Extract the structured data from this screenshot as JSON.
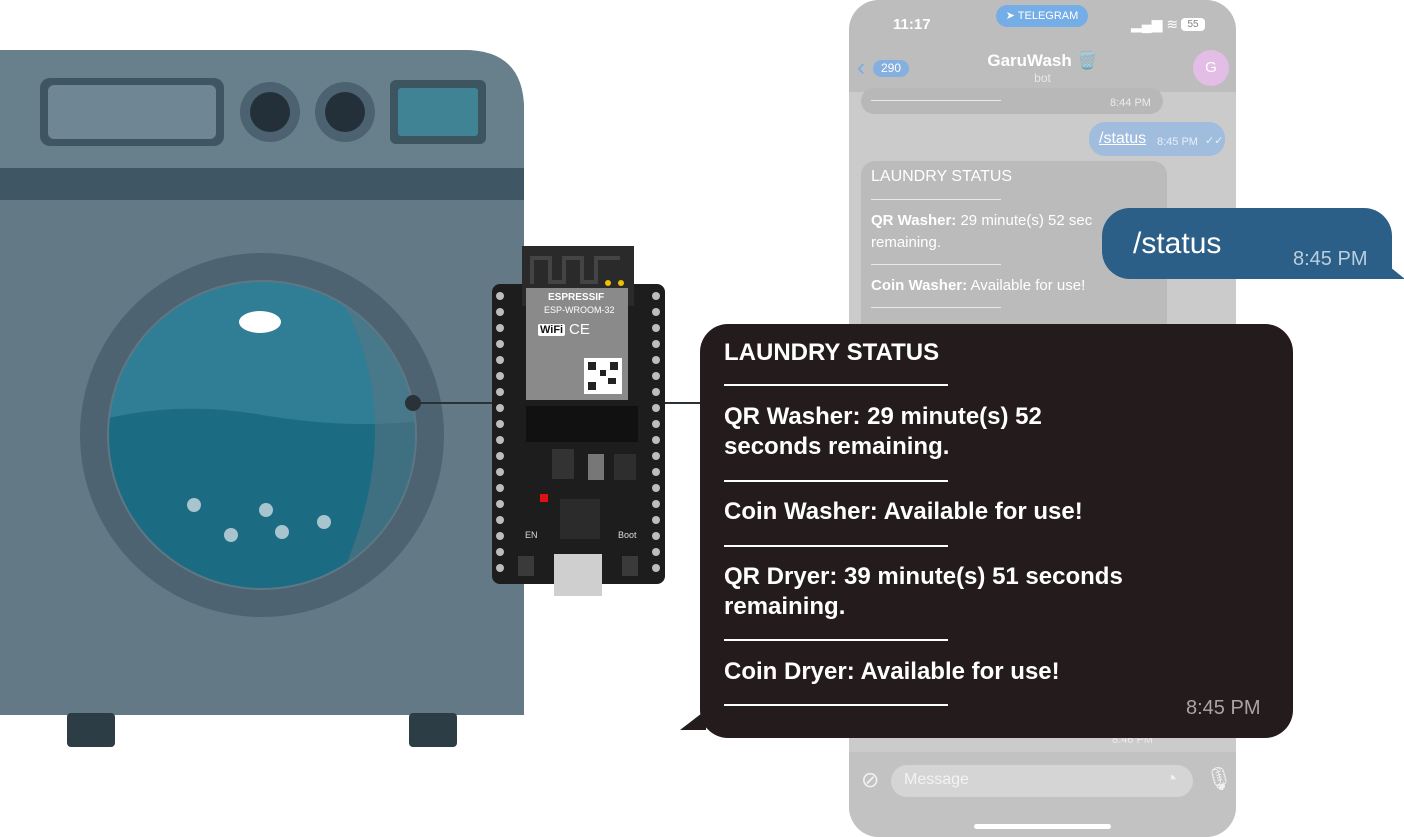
{
  "phone": {
    "time": "11:17",
    "telegram_pill": "TELEGRAM",
    "battery": "55",
    "back_count": "290",
    "chat_title": "GaruWash 🗑️",
    "chat_subtitle": "bot",
    "avatar_letter": "G",
    "prev_time": "8:44 PM",
    "sent_command": "/status",
    "sent_time": "8:45 PM",
    "status_bubble": {
      "title": "LAUNDRY STATUS",
      "qr_washer_label": "QR Washer:",
      "qr_washer_value": "29 minute(s) 52 sec",
      "qr_washer_value2": "remaining.",
      "coin_washer_label": "Coin Washer:",
      "coin_washer_value": "Available for use!"
    },
    "bottom_time": "8:46 PM",
    "message_placeholder": "Message"
  },
  "callout_command": {
    "text": "/status",
    "time": "8:45 PM"
  },
  "callout_reply": {
    "title": "LAUNDRY STATUS",
    "qr_washer": "QR Washer: 29 minute(s) 52 seconds remaining.",
    "qr_washer_l1": "QR Washer: 29 minute(s) 52",
    "qr_washer_l2": "seconds remaining.",
    "coin_washer": "Coin Washer: Available for use!",
    "qr_dryer_l1": "QR Dryer: 39 minute(s) 51 seconds",
    "qr_dryer_l2": "remaining.",
    "coin_dryer": "Coin Dryer: Available for use!",
    "time": "8:45 PM"
  },
  "board": {
    "brand": "ESPRESSIF",
    "model": "ESP-WROOM-32",
    "wifi": "WiFi",
    "ce": "CE",
    "en": "EN",
    "boot": "Boot"
  },
  "colors": {
    "washer_body": "#637986",
    "washer_panel": "#6b8291",
    "callout_command_bg": "#2c5f87",
    "callout_reply_bg": "#241b1d",
    "water": "#1d6f86"
  },
  "icons": [
    "chevron-left-icon",
    "telegram-icon",
    "signal-icon",
    "wifi-icon",
    "battery-icon",
    "attach-icon",
    "sticker-icon",
    "microphone-icon",
    "double-check-icon"
  ]
}
